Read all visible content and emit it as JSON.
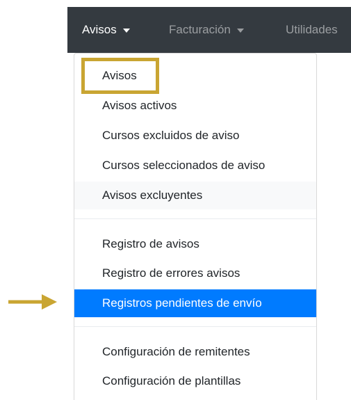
{
  "navbar": {
    "items": [
      {
        "label": "Avisos",
        "state": "active"
      },
      {
        "label": "Facturación",
        "state": "muted"
      },
      {
        "label": "Utilidades",
        "state": "muted"
      }
    ]
  },
  "dropdown": {
    "group1": [
      {
        "label": "Avisos"
      },
      {
        "label": "Avisos activos"
      },
      {
        "label": "Cursos excluidos de aviso"
      },
      {
        "label": "Cursos seleccionados de aviso"
      },
      {
        "label": "Avisos excluyentes",
        "state": "hover"
      }
    ],
    "group2": [
      {
        "label": "Registro de avisos"
      },
      {
        "label": "Registro de errores avisos"
      },
      {
        "label": "Registros pendientes de envío",
        "state": "selected"
      }
    ],
    "group3": [
      {
        "label": "Configuración de remitentes"
      },
      {
        "label": "Configuración de plantillas"
      }
    ]
  },
  "annotations": {
    "highlight_color": "#c9a532",
    "arrow_color": "#c9a532",
    "highlight_target": "dropdown-item-avisos",
    "arrow_target": "dropdown-item-registros-pendientes"
  },
  "colors": {
    "navbar_bg": "#343a40",
    "selected_bg": "#007bff",
    "hover_bg": "#f8f9fa"
  }
}
